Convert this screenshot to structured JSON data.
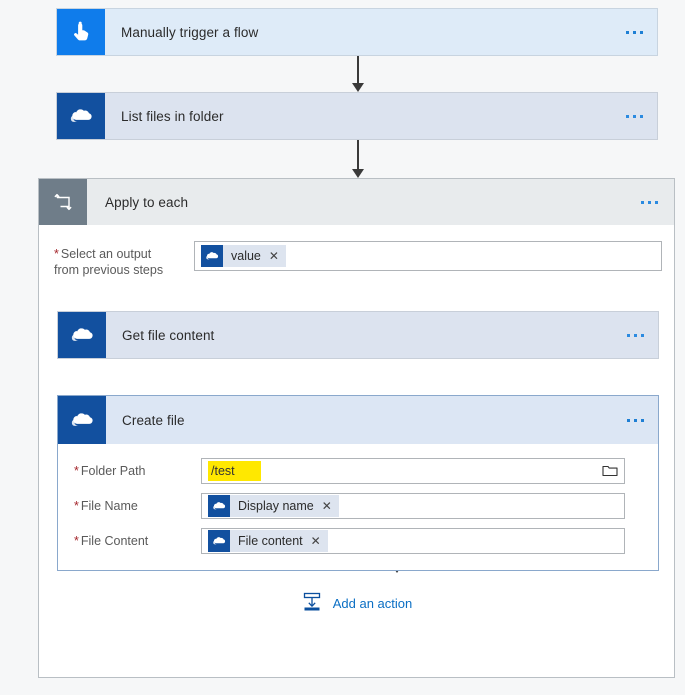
{
  "flow": {
    "trigger": {
      "title": "Manually trigger a flow",
      "icon": "tap-hand-icon",
      "menu": "more-options"
    },
    "steps": [
      {
        "title": "List files in folder",
        "icon": "onedrive-cloud-icon"
      }
    ],
    "loop": {
      "title": "Apply to each",
      "icon": "foreach-loop-icon",
      "select_output": {
        "label_line1": "Select an output",
        "label_line2": "from previous steps",
        "required": "*",
        "token": {
          "text": "value",
          "remove": "✕",
          "icon": "onedrive-cloud-icon"
        }
      },
      "inner_steps": [
        {
          "title": "Get file content",
          "icon": "onedrive-cloud-icon"
        }
      ],
      "create_file": {
        "title": "Create file",
        "icon": "onedrive-cloud-icon",
        "fields": [
          {
            "label": "Folder Path",
            "required": "*",
            "type": "highlighted-text",
            "value": "/test",
            "highlight_color": "#FFE800",
            "picker_icon": "folder-picker-icon"
          },
          {
            "label": "File Name",
            "required": "*",
            "type": "token",
            "token": {
              "text": "Display name",
              "remove": "✕",
              "icon": "onedrive-cloud-icon"
            }
          },
          {
            "label": "File Content",
            "required": "*",
            "type": "token",
            "token": {
              "text": "File content",
              "remove": "✕",
              "icon": "onedrive-cloud-icon"
            }
          }
        ]
      },
      "add_action": {
        "label": "Add an action",
        "icon": "insert-action-icon"
      }
    },
    "colors": {
      "trigger_bg": "#DEEBF8",
      "action_bg": "#DCE3EF",
      "selected_bg": "#DCE6F4",
      "loop_header_bg": "#E8EBED",
      "loop_icon_bg": "#6F7D89",
      "trigger_icon_bg": "#0F7CEB",
      "connector_icon_bg": "#12509F",
      "link_blue": "#0B6FC4",
      "required_red": "#A4262C",
      "page_bg": "#F6F7F8"
    }
  }
}
